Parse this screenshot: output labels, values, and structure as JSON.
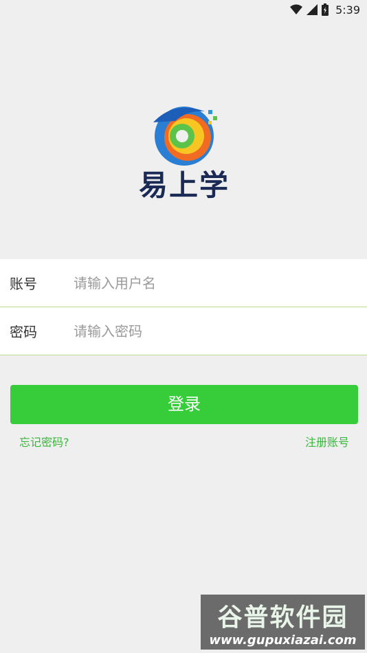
{
  "status_bar": {
    "time": "5:39"
  },
  "app": {
    "logo_text": "易上学"
  },
  "form": {
    "account": {
      "label": "账号",
      "placeholder": "请输入用户名"
    },
    "password": {
      "label": "密码",
      "placeholder": "请输入密码"
    }
  },
  "actions": {
    "login_label": "登录",
    "forgot_label": "忘记密码?",
    "register_label": "注册账号"
  },
  "watermark": {
    "title": "谷普软件园",
    "url": "www.gupuxiazai.com"
  },
  "colors": {
    "primary": "#37cc3a",
    "link": "#37b83a",
    "divider": "#b8e08a",
    "background": "#efefef"
  }
}
